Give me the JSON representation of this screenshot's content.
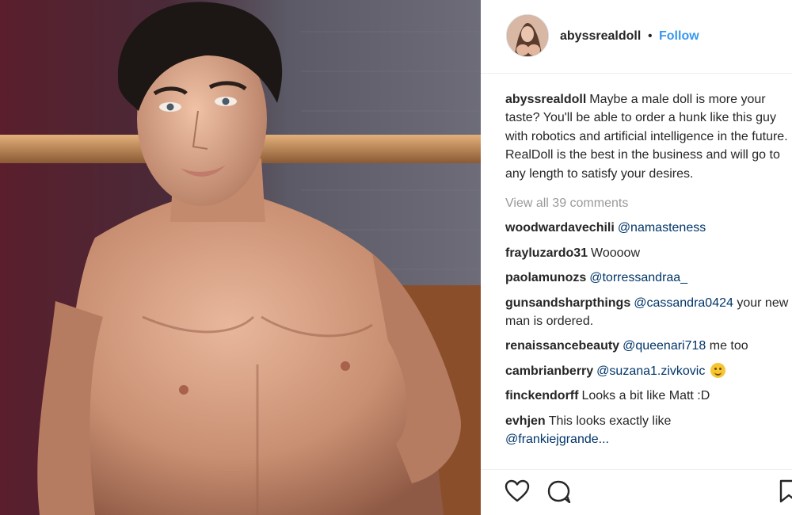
{
  "post": {
    "username": "abyssrealdoll",
    "follow_label": "Follow",
    "separator": "•",
    "caption": "Maybe a male doll is more your taste? You'll be able to order a hunk like this guy with robotics and artificial intelligence in the future. RealDoll is the best in the business and will go to any length to satisfy your desires.",
    "view_all_comments": "View all 39 comments"
  },
  "comments": [
    {
      "user": "woodwardavechili",
      "mention": "@namasteness",
      "text": ""
    },
    {
      "user": "frayluzardo31",
      "mention": "",
      "text": "Woooow"
    },
    {
      "user": "paolamunozs",
      "mention": "@torressandraa_",
      "text": ""
    },
    {
      "user": "gunsandsharpthings",
      "mention": "@cassandra0424",
      "text": "your new man is ordered."
    },
    {
      "user": "renaissancebeauty",
      "mention": "@queenari718",
      "text": "me too"
    },
    {
      "user": "cambrianberry",
      "mention": "@suzana1.zivkovic",
      "text": ""
    },
    {
      "user": "finckendorff",
      "mention": "",
      "text": "Looks a bit like Matt :D"
    },
    {
      "user": "evhjen",
      "mention": "",
      "text": "This looks exactly like",
      "trailing_mention": "@frankiejgrande..."
    }
  ],
  "icons": {
    "like": "heart-icon",
    "comment": "comment-icon",
    "save": "bookmark-icon",
    "emoji": "smiling-face-emoji"
  },
  "colors": {
    "link_blue": "#3897f0",
    "mention_navy": "#003569",
    "muted_gray": "#999999",
    "text": "#262626"
  }
}
